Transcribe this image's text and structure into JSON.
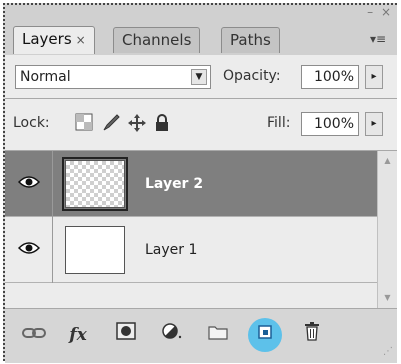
{
  "window": {
    "minimize": "–",
    "close": "×"
  },
  "tabs": [
    {
      "label": "Layers",
      "close": "×"
    },
    {
      "label": "Channels"
    },
    {
      "label": "Paths"
    }
  ],
  "panel_menu_icon": "▾≡",
  "blend": {
    "mode": "Normal",
    "arrow": "▼",
    "opacity_label": "Opacity:",
    "opacity_value": "100%",
    "flyout": "▸"
  },
  "lock": {
    "label": "Lock:",
    "fill_label": "Fill:",
    "fill_value": "100%",
    "flyout": "▸",
    "icons": [
      "lock-transparent-icon",
      "lock-brush-icon",
      "lock-move-icon",
      "lock-all-icon"
    ]
  },
  "layers": [
    {
      "name": "Layer 2",
      "selected": true,
      "thumb": "transparent",
      "eye": "◉"
    },
    {
      "name": "Layer 1",
      "selected": false,
      "thumb": "white",
      "eye": "◉"
    }
  ],
  "toolbar": {
    "icons": [
      "link-layers-icon",
      "fx-style-icon",
      "add-mask-icon",
      "adjustment-layer-icon",
      "new-group-icon",
      "new-layer-icon",
      "delete-layer-icon"
    ],
    "highlighted": "new-layer-icon",
    "fx_label": "fx"
  },
  "colors": {
    "panel": "#ececec",
    "selected_row": "#7f7f7f",
    "highlight": "#5dc1ea"
  }
}
